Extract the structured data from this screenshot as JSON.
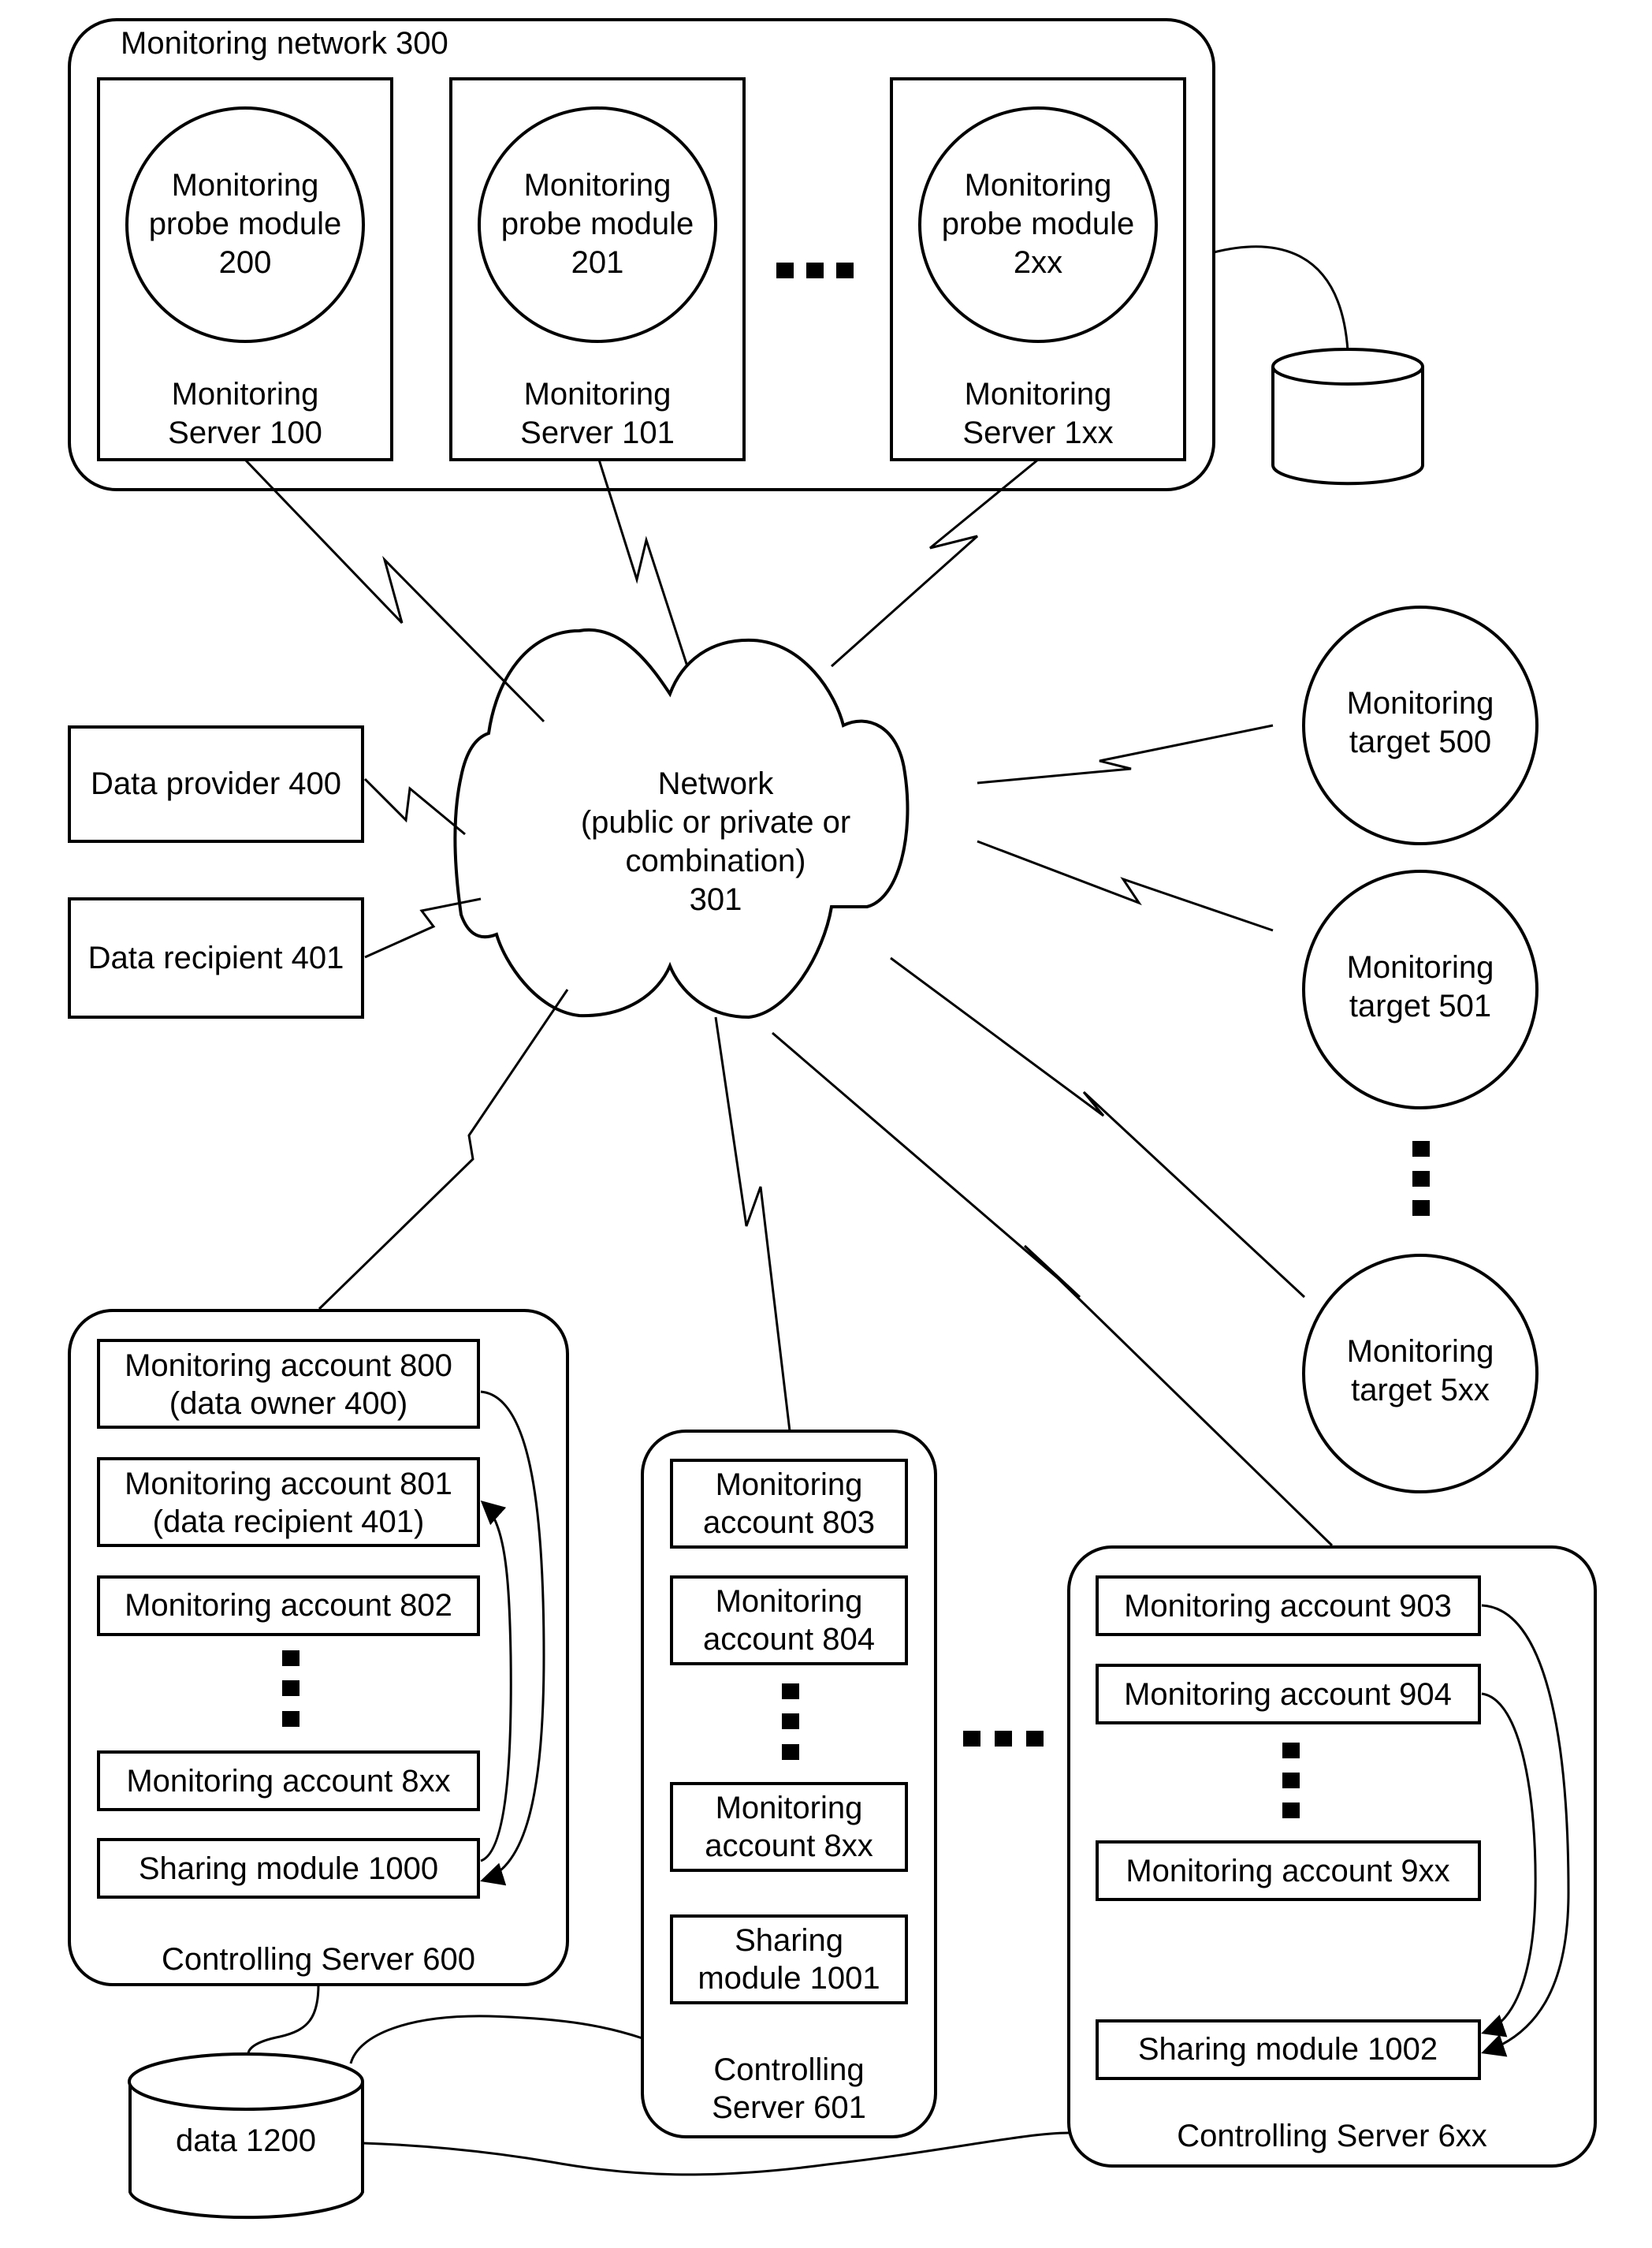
{
  "monitoring_network": {
    "title": "Monitoring network 300",
    "servers": [
      {
        "probe": [
          "Monitoring",
          "probe module",
          "200"
        ],
        "server": [
          "Monitoring",
          "Server 100"
        ]
      },
      {
        "probe": [
          "Monitoring",
          "probe module",
          "201"
        ],
        "server": [
          "Monitoring",
          "Server 101"
        ]
      },
      {
        "probe": [
          "Monitoring",
          "probe module",
          "2xx"
        ],
        "server": [
          "Monitoring",
          "Server 1xx"
        ]
      }
    ]
  },
  "network": {
    "lines": [
      "Network",
      "(public or private or",
      "combination)",
      "301"
    ]
  },
  "data_provider": "Data provider 400",
  "data_recipient": "Data recipient 401",
  "targets": [
    [
      "Monitoring",
      "target 500"
    ],
    [
      "Monitoring",
      "target 501"
    ],
    [
      "Monitoring",
      "target 5xx"
    ]
  ],
  "controlling_servers": [
    {
      "label": [
        "Controlling Server 600"
      ],
      "items": [
        [
          "Monitoring account 800",
          "(data owner 400)"
        ],
        [
          "Monitoring account 801",
          "(data recipient 401)"
        ],
        [
          "Monitoring account 802"
        ],
        [
          "Monitoring account 8xx"
        ],
        [
          "Sharing module 1000"
        ]
      ]
    },
    {
      "label": [
        "Controlling",
        "Server 601"
      ],
      "items": [
        [
          "Monitoring",
          "account 803"
        ],
        [
          "Monitoring",
          "account 804"
        ],
        [
          "Monitoring",
          "account 8xx"
        ],
        [
          "Sharing",
          "module 1001"
        ]
      ]
    },
    {
      "label": [
        "Controlling Server 6xx"
      ],
      "items": [
        [
          "Monitoring account 903"
        ],
        [
          "Monitoring account 904"
        ],
        [
          "Monitoring account 9xx"
        ],
        [
          "Sharing module 1002"
        ]
      ]
    }
  ],
  "data_store": "data 1200"
}
